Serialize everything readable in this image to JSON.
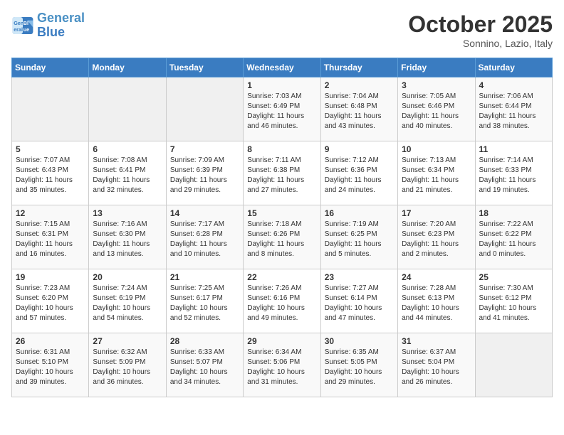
{
  "header": {
    "logo_line1": "General",
    "logo_line2": "Blue",
    "month": "October 2025",
    "location": "Sonnino, Lazio, Italy"
  },
  "weekdays": [
    "Sunday",
    "Monday",
    "Tuesday",
    "Wednesday",
    "Thursday",
    "Friday",
    "Saturday"
  ],
  "weeks": [
    [
      {
        "day": "",
        "info": ""
      },
      {
        "day": "",
        "info": ""
      },
      {
        "day": "",
        "info": ""
      },
      {
        "day": "1",
        "info": "Sunrise: 7:03 AM\nSunset: 6:49 PM\nDaylight: 11 hours\nand 46 minutes."
      },
      {
        "day": "2",
        "info": "Sunrise: 7:04 AM\nSunset: 6:48 PM\nDaylight: 11 hours\nand 43 minutes."
      },
      {
        "day": "3",
        "info": "Sunrise: 7:05 AM\nSunset: 6:46 PM\nDaylight: 11 hours\nand 40 minutes."
      },
      {
        "day": "4",
        "info": "Sunrise: 7:06 AM\nSunset: 6:44 PM\nDaylight: 11 hours\nand 38 minutes."
      }
    ],
    [
      {
        "day": "5",
        "info": "Sunrise: 7:07 AM\nSunset: 6:43 PM\nDaylight: 11 hours\nand 35 minutes."
      },
      {
        "day": "6",
        "info": "Sunrise: 7:08 AM\nSunset: 6:41 PM\nDaylight: 11 hours\nand 32 minutes."
      },
      {
        "day": "7",
        "info": "Sunrise: 7:09 AM\nSunset: 6:39 PM\nDaylight: 11 hours\nand 29 minutes."
      },
      {
        "day": "8",
        "info": "Sunrise: 7:11 AM\nSunset: 6:38 PM\nDaylight: 11 hours\nand 27 minutes."
      },
      {
        "day": "9",
        "info": "Sunrise: 7:12 AM\nSunset: 6:36 PM\nDaylight: 11 hours\nand 24 minutes."
      },
      {
        "day": "10",
        "info": "Sunrise: 7:13 AM\nSunset: 6:34 PM\nDaylight: 11 hours\nand 21 minutes."
      },
      {
        "day": "11",
        "info": "Sunrise: 7:14 AM\nSunset: 6:33 PM\nDaylight: 11 hours\nand 19 minutes."
      }
    ],
    [
      {
        "day": "12",
        "info": "Sunrise: 7:15 AM\nSunset: 6:31 PM\nDaylight: 11 hours\nand 16 minutes."
      },
      {
        "day": "13",
        "info": "Sunrise: 7:16 AM\nSunset: 6:30 PM\nDaylight: 11 hours\nand 13 minutes."
      },
      {
        "day": "14",
        "info": "Sunrise: 7:17 AM\nSunset: 6:28 PM\nDaylight: 11 hours\nand 10 minutes."
      },
      {
        "day": "15",
        "info": "Sunrise: 7:18 AM\nSunset: 6:26 PM\nDaylight: 11 hours\nand 8 minutes."
      },
      {
        "day": "16",
        "info": "Sunrise: 7:19 AM\nSunset: 6:25 PM\nDaylight: 11 hours\nand 5 minutes."
      },
      {
        "day": "17",
        "info": "Sunrise: 7:20 AM\nSunset: 6:23 PM\nDaylight: 11 hours\nand 2 minutes."
      },
      {
        "day": "18",
        "info": "Sunrise: 7:22 AM\nSunset: 6:22 PM\nDaylight: 11 hours\nand 0 minutes."
      }
    ],
    [
      {
        "day": "19",
        "info": "Sunrise: 7:23 AM\nSunset: 6:20 PM\nDaylight: 10 hours\nand 57 minutes."
      },
      {
        "day": "20",
        "info": "Sunrise: 7:24 AM\nSunset: 6:19 PM\nDaylight: 10 hours\nand 54 minutes."
      },
      {
        "day": "21",
        "info": "Sunrise: 7:25 AM\nSunset: 6:17 PM\nDaylight: 10 hours\nand 52 minutes."
      },
      {
        "day": "22",
        "info": "Sunrise: 7:26 AM\nSunset: 6:16 PM\nDaylight: 10 hours\nand 49 minutes."
      },
      {
        "day": "23",
        "info": "Sunrise: 7:27 AM\nSunset: 6:14 PM\nDaylight: 10 hours\nand 47 minutes."
      },
      {
        "day": "24",
        "info": "Sunrise: 7:28 AM\nSunset: 6:13 PM\nDaylight: 10 hours\nand 44 minutes."
      },
      {
        "day": "25",
        "info": "Sunrise: 7:30 AM\nSunset: 6:12 PM\nDaylight: 10 hours\nand 41 minutes."
      }
    ],
    [
      {
        "day": "26",
        "info": "Sunrise: 6:31 AM\nSunset: 5:10 PM\nDaylight: 10 hours\nand 39 minutes."
      },
      {
        "day": "27",
        "info": "Sunrise: 6:32 AM\nSunset: 5:09 PM\nDaylight: 10 hours\nand 36 minutes."
      },
      {
        "day": "28",
        "info": "Sunrise: 6:33 AM\nSunset: 5:07 PM\nDaylight: 10 hours\nand 34 minutes."
      },
      {
        "day": "29",
        "info": "Sunrise: 6:34 AM\nSunset: 5:06 PM\nDaylight: 10 hours\nand 31 minutes."
      },
      {
        "day": "30",
        "info": "Sunrise: 6:35 AM\nSunset: 5:05 PM\nDaylight: 10 hours\nand 29 minutes."
      },
      {
        "day": "31",
        "info": "Sunrise: 6:37 AM\nSunset: 5:04 PM\nDaylight: 10 hours\nand 26 minutes."
      },
      {
        "day": "",
        "info": ""
      }
    ]
  ]
}
